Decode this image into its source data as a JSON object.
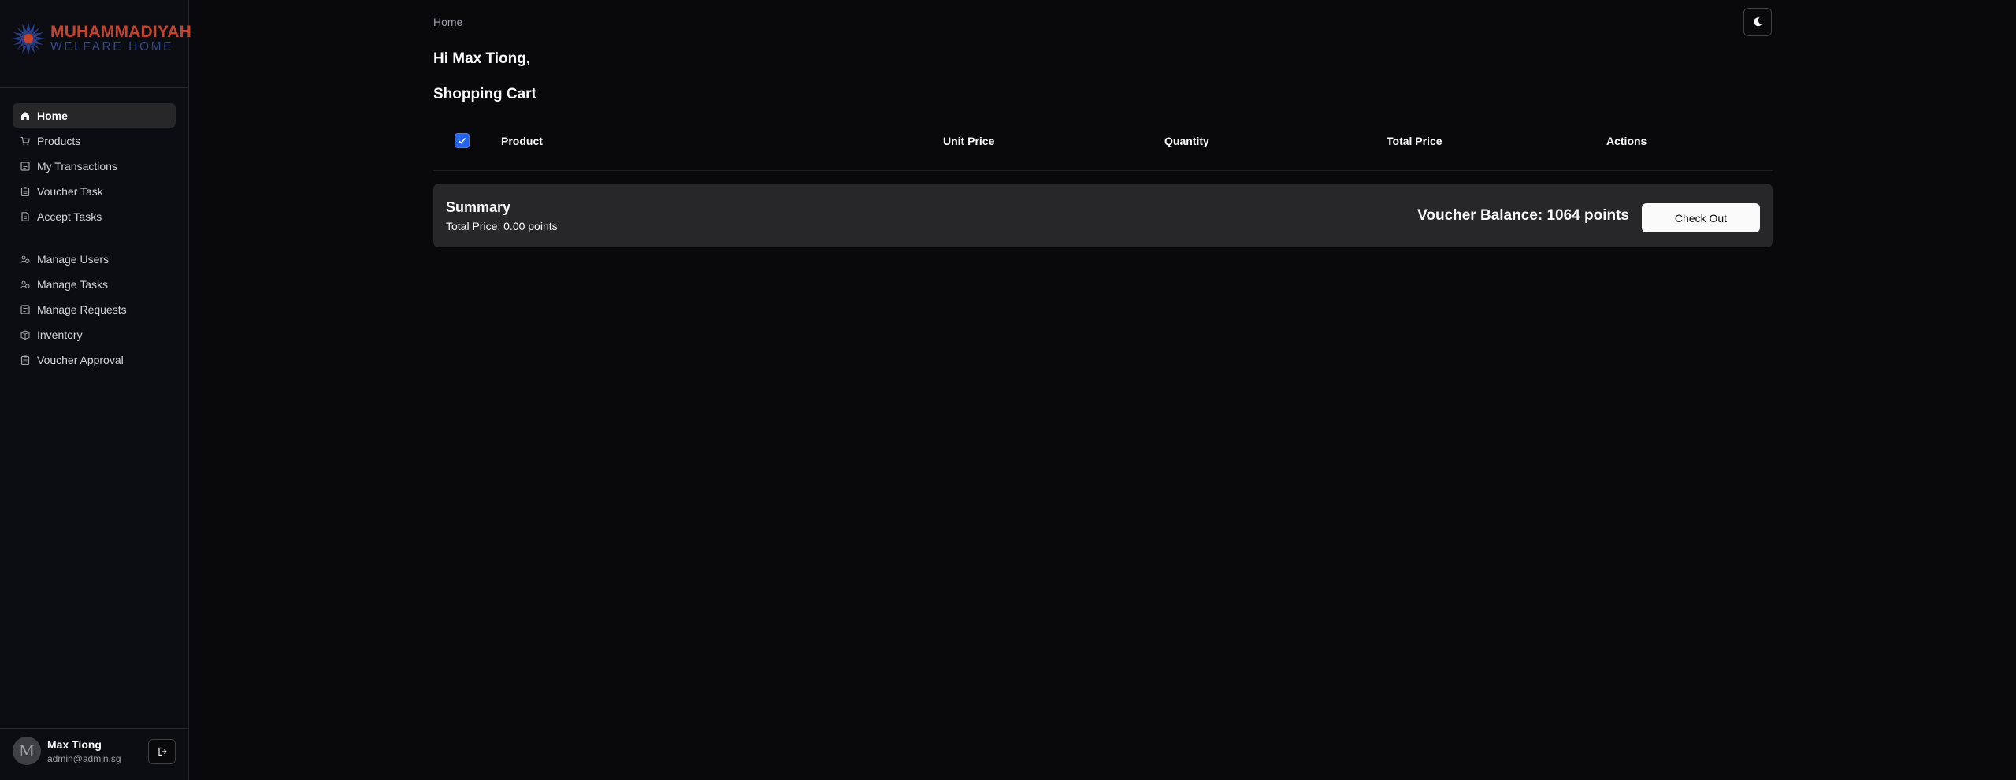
{
  "brand": {
    "line1": "MUHAMMADIYAH",
    "line2": "WELFARE HOME"
  },
  "colors": {
    "accent": "#2563eb",
    "brand_red": "#c8412b",
    "brand_blue": "#324a8c"
  },
  "nav_primary": [
    {
      "label": "Home",
      "icon": "home-icon",
      "active": true
    },
    {
      "label": "Products",
      "icon": "cart-icon"
    },
    {
      "label": "My Transactions",
      "icon": "transactions-icon"
    },
    {
      "label": "Voucher Task",
      "icon": "clipboard-icon"
    },
    {
      "label": "Accept Tasks",
      "icon": "file-icon"
    }
  ],
  "nav_admin": [
    {
      "label": "Manage Users",
      "icon": "users-icon"
    },
    {
      "label": "Manage Tasks",
      "icon": "users-icon"
    },
    {
      "label": "Manage Requests",
      "icon": "transactions-icon"
    },
    {
      "label": "Inventory",
      "icon": "package-icon"
    },
    {
      "label": "Voucher Approval",
      "icon": "clipboard-icon"
    }
  ],
  "user": {
    "initial": "M",
    "name": "Max Tiong",
    "email": "admin@admin.sg"
  },
  "breadcrumb": "Home",
  "greeting": "Hi Max Tiong,",
  "section_title": "Shopping Cart",
  "table": {
    "select_all_checked": true,
    "columns": [
      "Product",
      "Unit Price",
      "Quantity",
      "Total Price",
      "Actions"
    ]
  },
  "summary": {
    "title": "Summary",
    "total_price": "Total Price: 0.00 points",
    "voucher_balance": "Voucher Balance: 1064 points",
    "checkout_label": "Check Out"
  }
}
